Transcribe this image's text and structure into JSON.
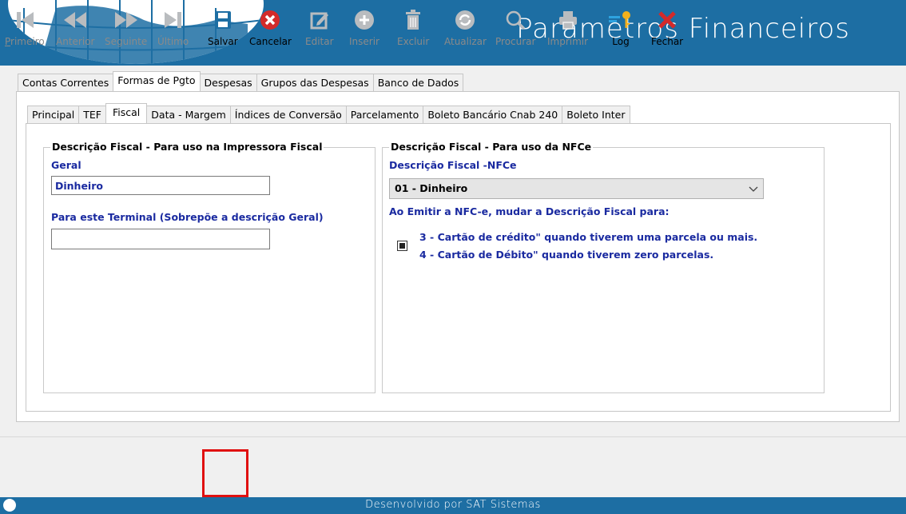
{
  "header": {
    "title": "Parâmetros Financeiros"
  },
  "outer_tabs": [
    "Contas Correntes",
    "Formas de Pgto",
    "Despesas",
    "Grupos das Despesas",
    "Banco de Dados"
  ],
  "inner_tabs": [
    "Principal",
    "TEF",
    "Fiscal",
    "Data - Margem",
    "Índices de Conversão",
    "Parcelamento",
    "Boleto Bancário Cnab 240",
    "Boleto Inter"
  ],
  "fiscal": {
    "left_group": {
      "title": "Descrição Fiscal - Para uso na Impressora Fiscal",
      "geral_label": "Geral",
      "geral_value": "Dinheiro",
      "terminal_label": "Para este Terminal (Sobrepõe a descrição Geral)",
      "terminal_value": ""
    },
    "right_group": {
      "title": "Descrição Fiscal - Para uso da NFCe",
      "nfce_label": "Descrição Fiscal -NFCe",
      "nfce_value": "01 - Dinheiro",
      "emitir_label": "Ao Emitir a NFC-e, mudar a Descrição Fiscal para:",
      "option_line1": "3 - Cartão de crédito\" quando tiverem uma parcela ou mais.",
      "option_line2": "4 - Cartão de Débito\" quando tiverem zero parcelas."
    }
  },
  "toolbar": {
    "primeiro": "Primeiro",
    "anterior": "Anterior",
    "seguinte": "Seguinte",
    "ultimo": "Último",
    "salvar": "Salvar",
    "cancelar": "Cancelar",
    "editar": "Editar",
    "inserir": "Inserir",
    "excluir": "Excluir",
    "atualizar": "Atualizar",
    "procurar": "Procurar",
    "imprimir": "Imprimir",
    "log": "Log",
    "fechar": "Fechar"
  },
  "status": {
    "text": "Desenvolvido por SAT Sistemas"
  },
  "colors": {
    "brand_blue": "#1d6ea3",
    "label_blue": "#1a2aa0",
    "highlight_red": "#e01010"
  }
}
